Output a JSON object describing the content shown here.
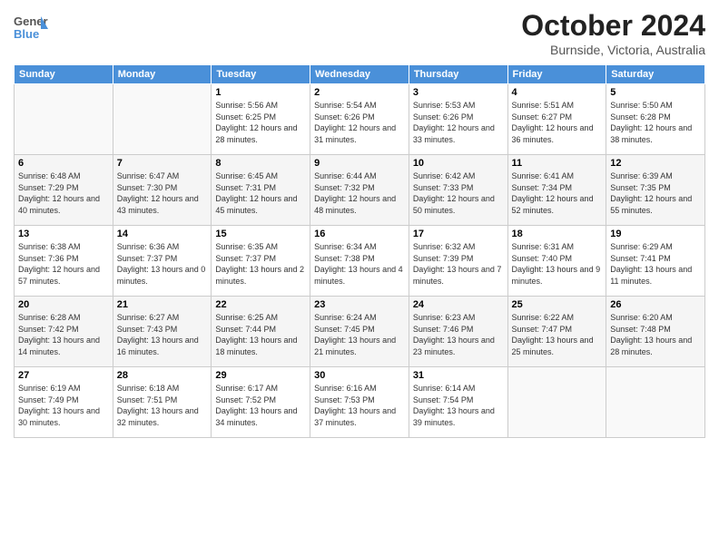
{
  "header": {
    "logo_general": "General",
    "logo_blue": "Blue",
    "month_title": "October 2024",
    "subtitle": "Burnside, Victoria, Australia"
  },
  "weekdays": [
    "Sunday",
    "Monday",
    "Tuesday",
    "Wednesday",
    "Thursday",
    "Friday",
    "Saturday"
  ],
  "weeks": [
    [
      {
        "day": "",
        "sunrise": "",
        "sunset": "",
        "daylight": ""
      },
      {
        "day": "",
        "sunrise": "",
        "sunset": "",
        "daylight": ""
      },
      {
        "day": "1",
        "sunrise": "Sunrise: 5:56 AM",
        "sunset": "Sunset: 6:25 PM",
        "daylight": "Daylight: 12 hours and 28 minutes."
      },
      {
        "day": "2",
        "sunrise": "Sunrise: 5:54 AM",
        "sunset": "Sunset: 6:26 PM",
        "daylight": "Daylight: 12 hours and 31 minutes."
      },
      {
        "day": "3",
        "sunrise": "Sunrise: 5:53 AM",
        "sunset": "Sunset: 6:26 PM",
        "daylight": "Daylight: 12 hours and 33 minutes."
      },
      {
        "day": "4",
        "sunrise": "Sunrise: 5:51 AM",
        "sunset": "Sunset: 6:27 PM",
        "daylight": "Daylight: 12 hours and 36 minutes."
      },
      {
        "day": "5",
        "sunrise": "Sunrise: 5:50 AM",
        "sunset": "Sunset: 6:28 PM",
        "daylight": "Daylight: 12 hours and 38 minutes."
      }
    ],
    [
      {
        "day": "6",
        "sunrise": "Sunrise: 6:48 AM",
        "sunset": "Sunset: 7:29 PM",
        "daylight": "Daylight: 12 hours and 40 minutes."
      },
      {
        "day": "7",
        "sunrise": "Sunrise: 6:47 AM",
        "sunset": "Sunset: 7:30 PM",
        "daylight": "Daylight: 12 hours and 43 minutes."
      },
      {
        "day": "8",
        "sunrise": "Sunrise: 6:45 AM",
        "sunset": "Sunset: 7:31 PM",
        "daylight": "Daylight: 12 hours and 45 minutes."
      },
      {
        "day": "9",
        "sunrise": "Sunrise: 6:44 AM",
        "sunset": "Sunset: 7:32 PM",
        "daylight": "Daylight: 12 hours and 48 minutes."
      },
      {
        "day": "10",
        "sunrise": "Sunrise: 6:42 AM",
        "sunset": "Sunset: 7:33 PM",
        "daylight": "Daylight: 12 hours and 50 minutes."
      },
      {
        "day": "11",
        "sunrise": "Sunrise: 6:41 AM",
        "sunset": "Sunset: 7:34 PM",
        "daylight": "Daylight: 12 hours and 52 minutes."
      },
      {
        "day": "12",
        "sunrise": "Sunrise: 6:39 AM",
        "sunset": "Sunset: 7:35 PM",
        "daylight": "Daylight: 12 hours and 55 minutes."
      }
    ],
    [
      {
        "day": "13",
        "sunrise": "Sunrise: 6:38 AM",
        "sunset": "Sunset: 7:36 PM",
        "daylight": "Daylight: 12 hours and 57 minutes."
      },
      {
        "day": "14",
        "sunrise": "Sunrise: 6:36 AM",
        "sunset": "Sunset: 7:37 PM",
        "daylight": "Daylight: 13 hours and 0 minutes."
      },
      {
        "day": "15",
        "sunrise": "Sunrise: 6:35 AM",
        "sunset": "Sunset: 7:37 PM",
        "daylight": "Daylight: 13 hours and 2 minutes."
      },
      {
        "day": "16",
        "sunrise": "Sunrise: 6:34 AM",
        "sunset": "Sunset: 7:38 PM",
        "daylight": "Daylight: 13 hours and 4 minutes."
      },
      {
        "day": "17",
        "sunrise": "Sunrise: 6:32 AM",
        "sunset": "Sunset: 7:39 PM",
        "daylight": "Daylight: 13 hours and 7 minutes."
      },
      {
        "day": "18",
        "sunrise": "Sunrise: 6:31 AM",
        "sunset": "Sunset: 7:40 PM",
        "daylight": "Daylight: 13 hours and 9 minutes."
      },
      {
        "day": "19",
        "sunrise": "Sunrise: 6:29 AM",
        "sunset": "Sunset: 7:41 PM",
        "daylight": "Daylight: 13 hours and 11 minutes."
      }
    ],
    [
      {
        "day": "20",
        "sunrise": "Sunrise: 6:28 AM",
        "sunset": "Sunset: 7:42 PM",
        "daylight": "Daylight: 13 hours and 14 minutes."
      },
      {
        "day": "21",
        "sunrise": "Sunrise: 6:27 AM",
        "sunset": "Sunset: 7:43 PM",
        "daylight": "Daylight: 13 hours and 16 minutes."
      },
      {
        "day": "22",
        "sunrise": "Sunrise: 6:25 AM",
        "sunset": "Sunset: 7:44 PM",
        "daylight": "Daylight: 13 hours and 18 minutes."
      },
      {
        "day": "23",
        "sunrise": "Sunrise: 6:24 AM",
        "sunset": "Sunset: 7:45 PM",
        "daylight": "Daylight: 13 hours and 21 minutes."
      },
      {
        "day": "24",
        "sunrise": "Sunrise: 6:23 AM",
        "sunset": "Sunset: 7:46 PM",
        "daylight": "Daylight: 13 hours and 23 minutes."
      },
      {
        "day": "25",
        "sunrise": "Sunrise: 6:22 AM",
        "sunset": "Sunset: 7:47 PM",
        "daylight": "Daylight: 13 hours and 25 minutes."
      },
      {
        "day": "26",
        "sunrise": "Sunrise: 6:20 AM",
        "sunset": "Sunset: 7:48 PM",
        "daylight": "Daylight: 13 hours and 28 minutes."
      }
    ],
    [
      {
        "day": "27",
        "sunrise": "Sunrise: 6:19 AM",
        "sunset": "Sunset: 7:49 PM",
        "daylight": "Daylight: 13 hours and 30 minutes."
      },
      {
        "day": "28",
        "sunrise": "Sunrise: 6:18 AM",
        "sunset": "Sunset: 7:51 PM",
        "daylight": "Daylight: 13 hours and 32 minutes."
      },
      {
        "day": "29",
        "sunrise": "Sunrise: 6:17 AM",
        "sunset": "Sunset: 7:52 PM",
        "daylight": "Daylight: 13 hours and 34 minutes."
      },
      {
        "day": "30",
        "sunrise": "Sunrise: 6:16 AM",
        "sunset": "Sunset: 7:53 PM",
        "daylight": "Daylight: 13 hours and 37 minutes."
      },
      {
        "day": "31",
        "sunrise": "Sunrise: 6:14 AM",
        "sunset": "Sunset: 7:54 PM",
        "daylight": "Daylight: 13 hours and 39 minutes."
      },
      {
        "day": "",
        "sunrise": "",
        "sunset": "",
        "daylight": ""
      },
      {
        "day": "",
        "sunrise": "",
        "sunset": "",
        "daylight": ""
      }
    ]
  ]
}
